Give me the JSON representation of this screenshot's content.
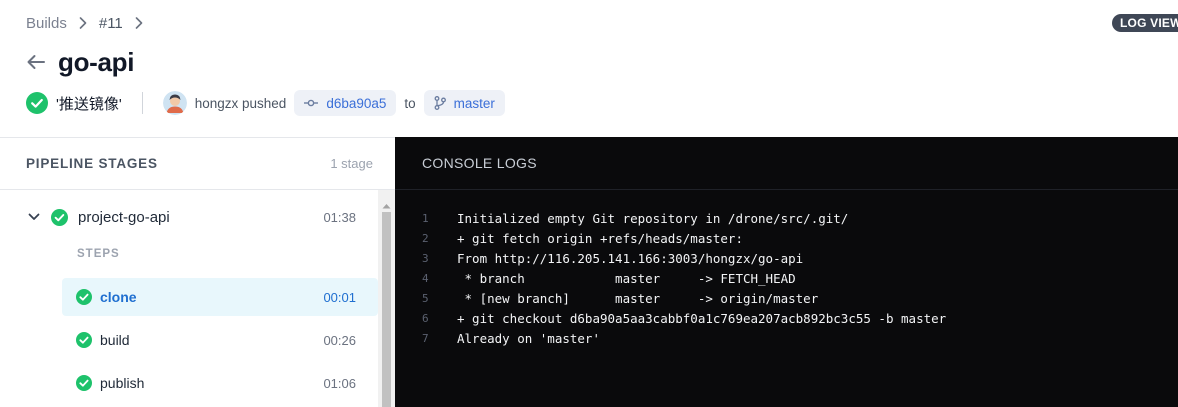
{
  "breadcrumb": {
    "items": [
      {
        "label": "Builds"
      },
      {
        "label": "#11"
      }
    ]
  },
  "badge": {
    "label": "LOG VIEW"
  },
  "page": {
    "title": "go-api"
  },
  "build": {
    "status": "success",
    "message": "'推送镜像'",
    "actor": "hongzx pushed",
    "commit": "d6ba90a5",
    "to_label": "to",
    "branch": "master"
  },
  "pipeline": {
    "title": "PIPELINE STAGES",
    "count": "1 stage",
    "stage": {
      "name": "project-go-api",
      "duration": "01:38"
    },
    "steps_label": "STEPS",
    "steps": [
      {
        "name": "clone",
        "duration": "00:01",
        "active": true
      },
      {
        "name": "build",
        "duration": "00:26",
        "active": false
      },
      {
        "name": "publish",
        "duration": "01:06",
        "active": false
      }
    ]
  },
  "console": {
    "title": "CONSOLE LOGS",
    "lines": [
      {
        "n": "1",
        "text": "Initialized empty Git repository in /drone/src/.git/"
      },
      {
        "n": "2",
        "text": "+ git fetch origin +refs/heads/master:"
      },
      {
        "n": "3",
        "text": "From http://116.205.141.166:3003/hongzx/go-api"
      },
      {
        "n": "4",
        "text": " * branch            master     -> FETCH_HEAD"
      },
      {
        "n": "5",
        "text": " * [new branch]      master     -> origin/master"
      },
      {
        "n": "6",
        "text": "+ git checkout d6ba90a5aa3cabbf0a1c769ea207acb892bc3c55 -b master"
      },
      {
        "n": "7",
        "text": "Already on 'master'"
      }
    ]
  },
  "colors": {
    "success": "#1ec26b",
    "accent": "#1f6fd0",
    "console_bg": "#0a0a0c"
  },
  "icons": [
    "chevron-right-icon",
    "back-arrow-icon",
    "check-circle-icon",
    "commit-icon",
    "branch-icon",
    "chevron-down-icon"
  ]
}
